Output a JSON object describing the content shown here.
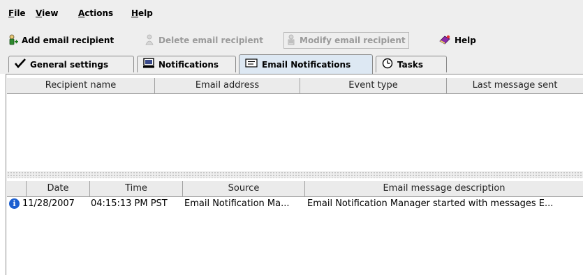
{
  "menu": [
    {
      "mnemonic": "F",
      "rest": "ile"
    },
    {
      "mnemonic": "V",
      "rest": "iew"
    },
    {
      "mnemonic": "A",
      "rest": "ctions"
    },
    {
      "mnemonic": "H",
      "rest": "elp"
    }
  ],
  "toolbar": {
    "add_label": "Add email recipient",
    "delete_label": "Delete email recipient",
    "modify_label": "Modify email recipient",
    "help_label": "Help"
  },
  "tabs": [
    {
      "label": "General settings",
      "icon": "checkmark-icon"
    },
    {
      "label": "Notifications",
      "icon": "computer-icon"
    },
    {
      "label": "Email Notifications",
      "icon": "envelope-icon",
      "active": true
    },
    {
      "label": "Tasks",
      "icon": "clock-icon"
    }
  ],
  "recipients_table": {
    "columns": [
      "Recipient name",
      "Email address",
      "Event type",
      "Last message sent"
    ],
    "rows": []
  },
  "messages_table": {
    "columns": [
      "",
      "Date",
      "Time",
      "Source",
      "Email message description"
    ],
    "rows": [
      {
        "icon": "info-icon",
        "date": "11/28/2007",
        "time": "04:15:13 PM PST",
        "source": "Email Notification Ma...",
        "description": "Email Notification Manager started with messages E..."
      }
    ]
  },
  "colors": {
    "background": "#eeeeee",
    "active_tab": "#dde8f3",
    "info_icon": "#1c5fd0"
  }
}
